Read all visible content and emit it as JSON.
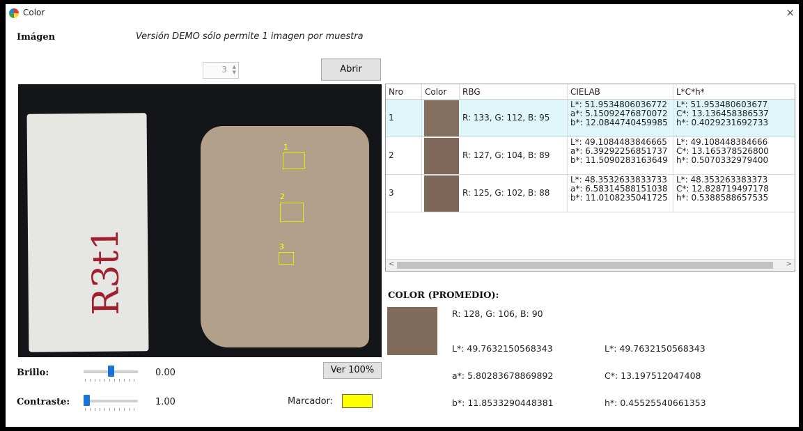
{
  "window": {
    "title": "Color",
    "close_label": "×"
  },
  "header": {
    "image_label": "Imágen",
    "demo_notice": "Versión DEMO sólo permite 1 imagen por muestra"
  },
  "spinner": {
    "value": "3",
    "arrows": "▲\n▼"
  },
  "buttons": {
    "open": "Abrir",
    "view100": "Ver 100%"
  },
  "photo": {
    "sample_writing": "R3t1",
    "markers": [
      {
        "label": "1"
      },
      {
        "label": "2"
      },
      {
        "label": "3"
      }
    ]
  },
  "controls": {
    "brightness_label": "Brillo:",
    "brightness_value": "0.00",
    "brightness_level": 0.5,
    "contrast_label": "Contraste:",
    "contrast_value": "1.00",
    "contrast_level": 0.0,
    "marker_label": "Marcador:",
    "marker_color": "#ffff00"
  },
  "table": {
    "columns": [
      "Nro",
      "Color",
      "RBG",
      "CIELAB",
      "L*C*h*"
    ],
    "rows": [
      {
        "nro": "1",
        "swatch": "#85705f",
        "rgb": "R: 133, G: 112, B: 95",
        "lab": [
          "L*: 51.9534806036772",
          "a*: 5.15092476870072",
          "b*: 12.0844740459985"
        ],
        "lch": [
          "L*: 51.953480603677",
          "C*: 13.136458386537",
          "h*: 0.4029231692733"
        ]
      },
      {
        "nro": "2",
        "swatch": "#7f6859",
        "rgb": "R: 127, G: 104, B: 89",
        "lab": [
          "L*: 49.1084483846665",
          "a*: 6.39292256851737",
          "b*: 11.5090283163649"
        ],
        "lch": [
          "L*: 49.108448384666",
          "C*: 13.165378526800",
          "h*: 0.5070332979400"
        ]
      },
      {
        "nro": "3",
        "swatch": "#7d6658",
        "rgb": "R: 125, G: 102, B: 88",
        "lab": [
          "L*: 48.3532633833733",
          "a*: 6.58314588151038",
          "b*: 11.0108235041725"
        ],
        "lch": [
          "L*: 48.353263383373",
          "C*: 12.828719497178",
          "h*: 0.5388588657535"
        ]
      }
    ],
    "scroll_left": "<",
    "scroll_right": ">"
  },
  "average": {
    "title": "COLOR (PROMEDIO):",
    "swatch": "#806a5a",
    "rgb": "R: 128, G: 106, B: 90",
    "lab": [
      "L*: 49.7632150568343",
      "a*: 5.80283678869892",
      "b*: 11.8533290448381"
    ],
    "lch": [
      "L*: 49.7632150568343",
      "C*: 13.197512047408",
      "h*: 0.45525540661353"
    ]
  },
  "colors": {
    "selected_row": "#dff6fb",
    "slider_thumb": "#1a73d9"
  }
}
